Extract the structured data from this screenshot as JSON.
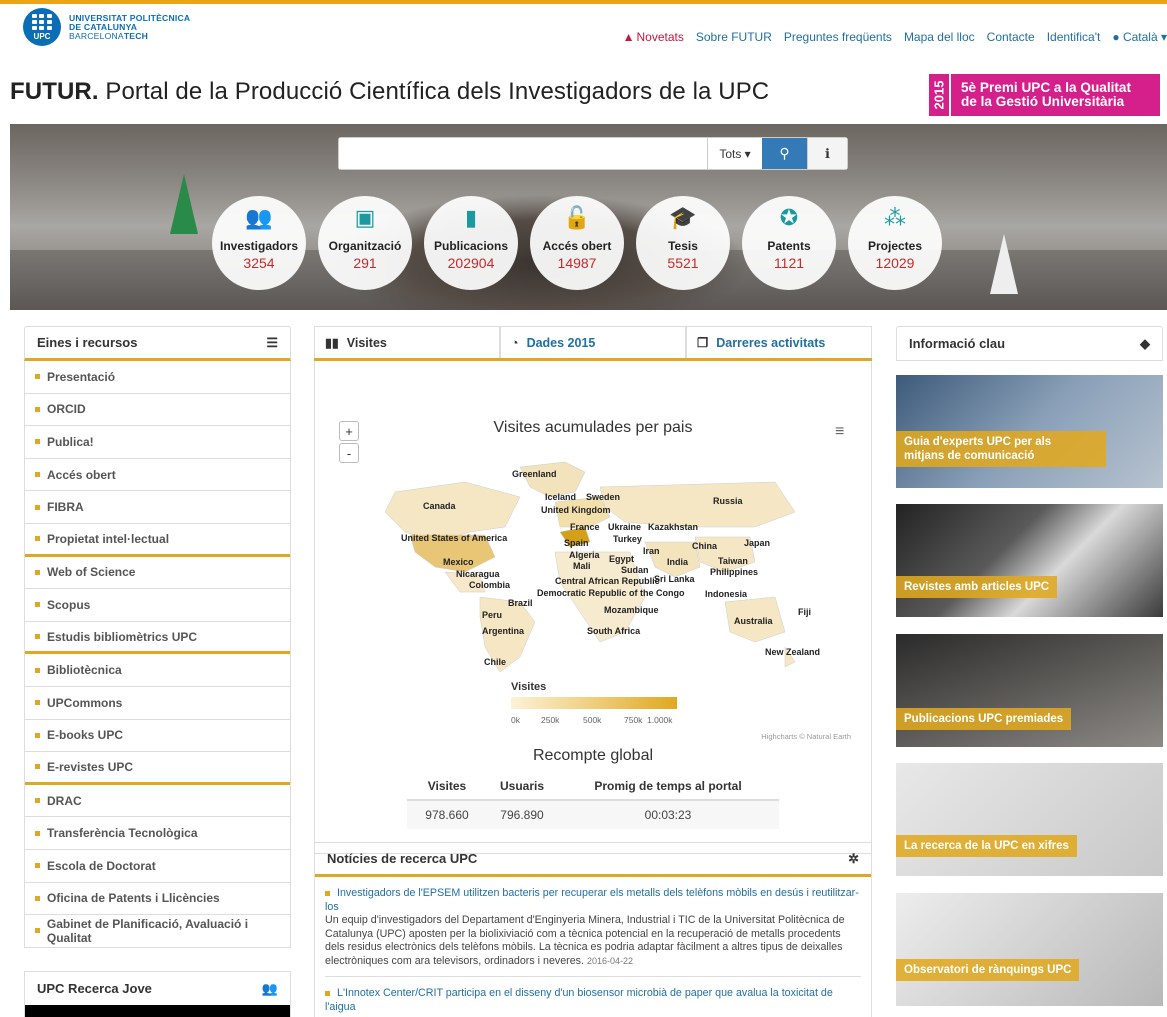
{
  "university": {
    "name_line1": "UNIVERSITAT POLITÈCNICA",
    "name_line2": "DE CATALUNYA",
    "name_line3a": "BARCELONA",
    "name_line3b": "TECH",
    "logo_abbr": "UPC"
  },
  "toplinks": {
    "novetats": "Novetats",
    "sobre": "Sobre FUTUR",
    "preguntes": "Preguntes freqüents",
    "mapa": "Mapa del lloc",
    "contacte": "Contacte",
    "identifica": "Identifica't",
    "lang": "Català"
  },
  "title": {
    "bold": "FUTUR.",
    "rest": " Portal de la Producció Científica dels Investigadors de la UPC"
  },
  "premi": {
    "year": "2015",
    "line1": "5è Premi UPC a la Qualitat",
    "line2": "de la Gestió Universitària"
  },
  "search": {
    "value": "",
    "scope": "Tots"
  },
  "stats": [
    {
      "label": "Investigadors",
      "count": "3254",
      "icon": "users-icon"
    },
    {
      "label": "Organització",
      "count": "291",
      "icon": "cubes-icon"
    },
    {
      "label": "Publicacions",
      "count": "202904",
      "icon": "file-icon"
    },
    {
      "label": "Accés obert",
      "count": "14987",
      "icon": "unlock-icon"
    },
    {
      "label": "Tesis",
      "count": "5521",
      "icon": "graduation-cap-icon"
    },
    {
      "label": "Patents",
      "count": "1121",
      "icon": "award-icon"
    },
    {
      "label": "Projectes",
      "count": "12029",
      "icon": "sitemap-icon"
    }
  ],
  "eines": {
    "title": "Eines i recursos",
    "items": [
      "Presentació",
      "ORCID",
      "Publica!",
      "Accés obert",
      "FIBRA",
      "Propietat intel·lectual",
      "Web of Science",
      "Scopus",
      "Estudis bibliomètrics UPC",
      "Bibliotècnica",
      "UPCommons",
      "E-books UPC",
      "E-revistes UPC",
      "DRAC",
      "Transferència Tecnològica",
      "Escola de Doctorat",
      "Oficina de Patents i Llicències",
      "Gabinet de Planificació, Avaluació i Qualitat"
    ]
  },
  "jove": {
    "title": "UPC Recerca Jove"
  },
  "tabs": {
    "visites": "Visites",
    "dades": "Dades 2015",
    "darreres": "Darreres activitats"
  },
  "map": {
    "title": "Visites acumulades per pais",
    "zoom_in": "+",
    "zoom_out": "-",
    "countries": [
      "Greenland",
      "Iceland",
      "Sweden",
      "United Kingdom",
      "Russia",
      "Canada",
      "France",
      "Ukraine",
      "Kazakhstan",
      "Turkey",
      "Spain",
      "Iran",
      "China",
      "Japan",
      "United States of America",
      "Algeria",
      "Mali",
      "Egypt",
      "India",
      "Taiwan",
      "Philippines",
      "Mexico",
      "Sudan",
      "Sri Lanka",
      "Nicaragua",
      "Central African Republic",
      "Colombia",
      "Democratic Republic of the Congo",
      "Indonesia",
      "Peru",
      "Brazil",
      "Mozambique",
      "Fiji",
      "Australia",
      "Argentina",
      "South Africa",
      "New Zealand",
      "Chile"
    ],
    "legend_title": "Visites",
    "legend_ticks": [
      "0k",
      "250k",
      "500k",
      "750k",
      "1.000k"
    ],
    "credit": "Highcharts © Natural Earth",
    "accent": "#e0a820"
  },
  "recompte": {
    "title": "Recompte global",
    "headers": [
      "Visites",
      "Usuaris",
      "Promig de temps al portal"
    ],
    "values": [
      "978.660",
      "796.890",
      "00:03:23"
    ]
  },
  "news": {
    "title": "Notícies de recerca UPC",
    "items": [
      {
        "title": "Investigadors de l'EPSEM utilitzen bacteris per recuperar els metalls dels telèfons mòbils en desús i reutilitzar-los",
        "text": "Un equip d'investigadors del Departament d'Enginyeria Minera, Industrial i TIC de la Universitat Politècnica de Catalunya (UPC) aposten per la biolixiviació com a tècnica potencial en la recuperació de metalls procedents dels residus electrònics dels telèfons mòbils. La tècnica es podria adaptar fàcilment a altres tipus de deixalles electròniques com ara televisors, ordinadors i neveres.",
        "date": "2016-04-22"
      },
      {
        "title": "L'Innotex Center/CRIT participa en el disseny d'un biosensor microbià de paper que avalua la toxicitat de l'aigua",
        "text": "",
        "date": ""
      }
    ]
  },
  "info": {
    "title": "Informació clau",
    "tiles": [
      {
        "line1": "Guia d'experts UPC per als",
        "line2": "mitjans de comunicació"
      },
      {
        "line1": "Revistes amb articles UPC",
        "line2": ""
      },
      {
        "line1": "Publicacions UPC premiades",
        "line2": ""
      },
      {
        "line1": "La recerca de la UPC en xifres",
        "line2": ""
      },
      {
        "line1": "Observatori de rànquings UPC",
        "line2": ""
      }
    ]
  }
}
